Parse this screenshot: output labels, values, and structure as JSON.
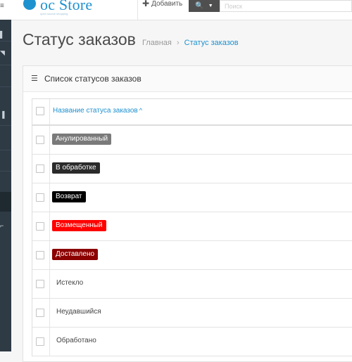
{
  "header": {
    "logo_text": "oc Store",
    "logo_tagline": "open source shopping",
    "add_label": "Добавить",
    "search_placeholder": "Поиск",
    "icons": {
      "add": "plus-icon",
      "search": "search-icon",
      "dropdown": "caret-down-icon",
      "logo": "opencart-logo-icon"
    }
  },
  "page": {
    "title": "Статус заказов",
    "breadcrumb": {
      "home": "Главная",
      "separator": "›",
      "current": "Статус заказов"
    }
  },
  "panel": {
    "title": "Список статусов заказов",
    "icon": "list-icon"
  },
  "table": {
    "header": {
      "name_column": "Название статуса заказов",
      "sort_indicator": "^"
    },
    "rows": [
      {
        "name": "Анулированный",
        "badge": true,
        "color": "#7a7a7a"
      },
      {
        "name": "В обработке",
        "badge": true,
        "color": "#2b2b2b"
      },
      {
        "name": "Возврат",
        "badge": true,
        "color": "#000000"
      },
      {
        "name": "Возмещенный",
        "badge": true,
        "color": "#ff0000"
      },
      {
        "name": "Доставлено",
        "badge": true,
        "color": "#8b0000"
      },
      {
        "name": "Истекло",
        "badge": false
      },
      {
        "name": "Неудавшийся",
        "badge": false
      },
      {
        "name": "Обработано",
        "badge": false
      }
    ]
  },
  "colors": {
    "accent": "#1e91cf",
    "sidebar": "#2e3a44",
    "search_button": "#4f4f4f"
  }
}
